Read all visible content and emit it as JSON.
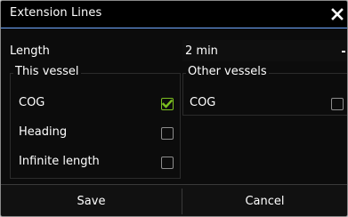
{
  "dialog": {
    "title": "Extension Lines",
    "close_icon": "close-icon"
  },
  "length": {
    "label": "Length",
    "selected": "2 min"
  },
  "this_vessel": {
    "label": "This vessel",
    "items": [
      {
        "label": "COG",
        "checked": true
      },
      {
        "label": "Heading",
        "checked": false
      },
      {
        "label": "Infinite length",
        "checked": false
      }
    ]
  },
  "other_vessels": {
    "label": "Other vessels",
    "items": [
      {
        "label": "COG",
        "checked": false
      }
    ]
  },
  "buttons": {
    "save": "Save",
    "cancel": "Cancel"
  },
  "colors": {
    "accent": "#6fa8ff",
    "check": "#7cbf1f"
  }
}
